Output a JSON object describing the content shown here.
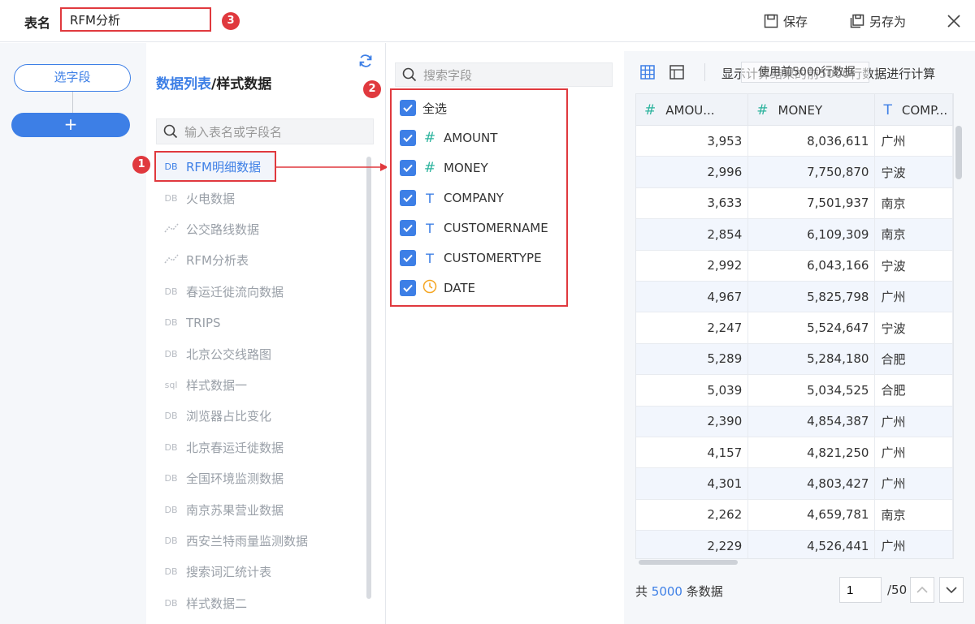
{
  "header": {
    "table_name_label": "表名",
    "table_name_value": "RFM分析",
    "save_label": "保存",
    "save_as_label": "另存为",
    "close_icon": "close-icon"
  },
  "badges": [
    "1",
    "2",
    "3"
  ],
  "steps": {
    "select_field_label": "选字段",
    "add_label": "+"
  },
  "table_list": {
    "title_part1": "数据列表",
    "title_part2": "/样式数据",
    "search_placeholder": "输入表名或字段名",
    "items": [
      {
        "icon": "DB",
        "label": "RFM明细数据",
        "selected": true
      },
      {
        "icon": "DB",
        "label": "火电数据"
      },
      {
        "icon": "line-chart-icon",
        "label": "公交路线数据"
      },
      {
        "icon": "line-chart-icon",
        "label": "RFM分析表"
      },
      {
        "icon": "DB",
        "label": "春运迁徙流向数据"
      },
      {
        "icon": "DB",
        "label": "TRIPS"
      },
      {
        "icon": "DB",
        "label": "北京公交线路图"
      },
      {
        "icon": "sql",
        "label": "样式数据一"
      },
      {
        "icon": "DB",
        "label": "浏览器占比变化"
      },
      {
        "icon": "DB",
        "label": "北京春运迁徙数据"
      },
      {
        "icon": "DB",
        "label": "全国环境监测数据"
      },
      {
        "icon": "DB",
        "label": "南京苏果营业数据"
      },
      {
        "icon": "DB",
        "label": "西安兰特雨量监测数据"
      },
      {
        "icon": "DB",
        "label": "搜索词汇统计表"
      },
      {
        "icon": "DB",
        "label": "样式数据二"
      }
    ]
  },
  "fields": {
    "search_placeholder": "搜索字段",
    "select_all_label": "全选",
    "items": [
      {
        "type": "#",
        "name": "AMOUNT",
        "checked": true
      },
      {
        "type": "#",
        "name": "MONEY",
        "checked": true
      },
      {
        "type": "T",
        "name": "COMPANY",
        "checked": true
      },
      {
        "type": "T",
        "name": "CUSTOMERNAME",
        "checked": true
      },
      {
        "type": "T",
        "name": "CUSTOMERTYPE",
        "checked": true
      },
      {
        "type": "clock",
        "name": "DATE",
        "checked": true
      }
    ]
  },
  "preview": {
    "calc_text": "显示计算结果的前5000行数据进行计算",
    "overlap_text": "使用前5000行数据",
    "columns": [
      {
        "type": "#",
        "name": "AMOU..."
      },
      {
        "type": "#",
        "name": "MONEY"
      },
      {
        "type": "T",
        "name": "COMP..."
      }
    ],
    "rows": [
      [
        "3,953",
        "8,036,611",
        "广州"
      ],
      [
        "2,996",
        "7,750,870",
        "宁波"
      ],
      [
        "3,633",
        "7,501,937",
        "南京"
      ],
      [
        "2,854",
        "6,109,309",
        "南京"
      ],
      [
        "2,992",
        "6,043,166",
        "宁波"
      ],
      [
        "4,967",
        "5,825,798",
        "广州"
      ],
      [
        "2,247",
        "5,524,647",
        "宁波"
      ],
      [
        "5,289",
        "5,284,180",
        "合肥"
      ],
      [
        "5,039",
        "5,034,525",
        "合肥"
      ],
      [
        "2,390",
        "4,854,387",
        "广州"
      ],
      [
        "4,157",
        "4,821,250",
        "广州"
      ],
      [
        "4,301",
        "4,803,427",
        "广州"
      ],
      [
        "2,262",
        "4,659,781",
        "南京"
      ],
      [
        "2,229",
        "4,526,441",
        "广州"
      ]
    ],
    "footer_prefix": "共",
    "total_count": "5000",
    "footer_suffix": "条数据",
    "page_current": "1",
    "page_total": "/50"
  },
  "colors": {
    "accent": "#3d7fe6",
    "annotation_red": "#e0393e",
    "numeric_type": "#2bb39d",
    "date_type": "#f5a623"
  }
}
